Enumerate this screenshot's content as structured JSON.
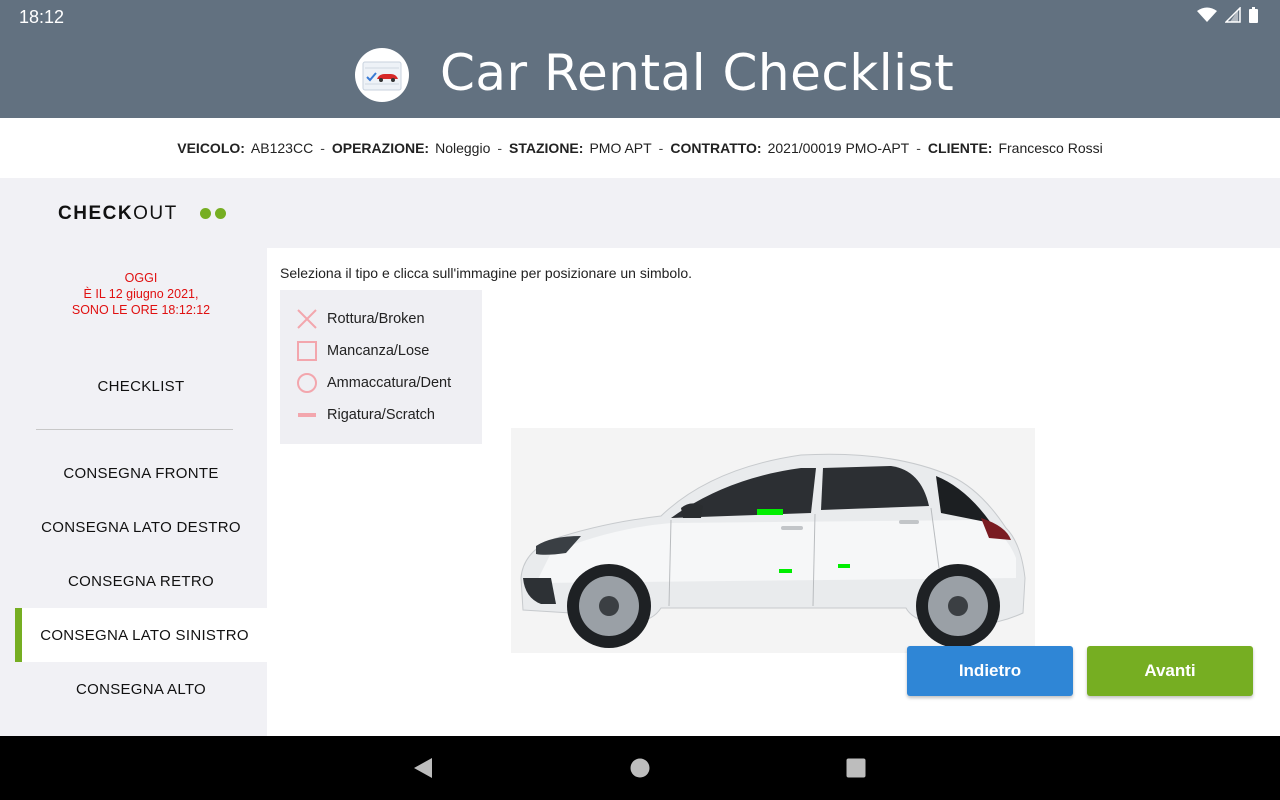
{
  "status_bar": {
    "time": "18:12"
  },
  "app": {
    "title": "Car Rental Checklist"
  },
  "info": {
    "vehicle_label": "VEICOLO:",
    "vehicle": "AB123CC",
    "operation_label": "OPERAZIONE:",
    "operation": "Noleggio",
    "station_label": "STAZIONE:",
    "station": "PMO APT",
    "contract_label": "CONTRATTO:",
    "contract": "2021/00019 PMO-APT",
    "client_label": "CLIENTE:",
    "client": "Francesco Rossi",
    "separator": "-"
  },
  "checkout": {
    "bold": "CHECK",
    "rest": "OUT"
  },
  "date": {
    "line1": "OGGI",
    "line2": "È IL 12 giugno 2021,",
    "line3": "SONO LE ORE 18:12:12"
  },
  "sidebar": {
    "items": [
      {
        "label": "CHECKLIST"
      },
      {
        "label": "CONSEGNA FRONTE"
      },
      {
        "label": "CONSEGNA LATO DESTRO"
      },
      {
        "label": "CONSEGNA RETRO"
      },
      {
        "label": "CONSEGNA LATO SINISTRO",
        "active": true
      },
      {
        "label": "CONSEGNA ALTO"
      }
    ]
  },
  "main": {
    "instruction": "Seleziona il tipo e clicca sull'immagine per posizionare un simbolo.",
    "legend": [
      {
        "label": "Rottura/Broken",
        "icon": "cross-icon"
      },
      {
        "label": "Mancanza/Lose",
        "icon": "square-icon"
      },
      {
        "label": "Ammaccatura/Dent",
        "icon": "circle-icon"
      },
      {
        "label": "Rigatura/Scratch",
        "icon": "dash-icon"
      }
    ],
    "back_label": "Indietro",
    "next_label": "Avanti"
  },
  "colors": {
    "appbar": "#627180",
    "accent_green": "#76ae22",
    "button_blue": "#2f86d6",
    "date_red": "#e01010",
    "legend_pink": "#f3a6ad",
    "marker_green": "#00ee00"
  }
}
